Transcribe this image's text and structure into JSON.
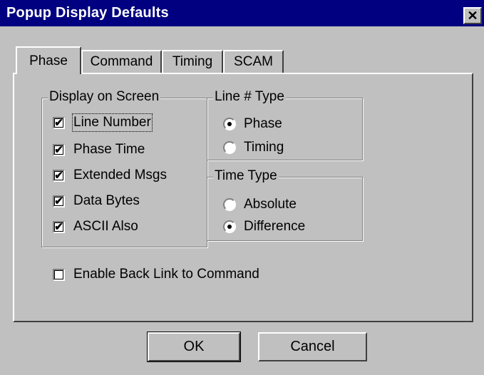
{
  "window": {
    "title": "Popup Display Defaults",
    "close_glyph": "✕"
  },
  "tabs": [
    {
      "label": "Phase",
      "active": true
    },
    {
      "label": "Command",
      "active": false
    },
    {
      "label": "Timing",
      "active": false
    },
    {
      "label": "SCAM",
      "active": false
    }
  ],
  "display_group": {
    "title": "Display on Screen",
    "items": [
      {
        "label": "Line Number",
        "checked": true
      },
      {
        "label": "Phase Time",
        "checked": true
      },
      {
        "label": "Extended Msgs",
        "checked": true
      },
      {
        "label": "Data Bytes",
        "checked": true
      },
      {
        "label": "ASCII Also",
        "checked": true
      }
    ]
  },
  "line_type_group": {
    "title": "Line # Type",
    "options": [
      {
        "label": "Phase",
        "selected": true
      },
      {
        "label": "Timing",
        "selected": false
      }
    ]
  },
  "time_type_group": {
    "title": "Time Type",
    "options": [
      {
        "label": "Absolute",
        "selected": false
      },
      {
        "label": "Difference",
        "selected": true
      }
    ]
  },
  "back_link": {
    "label": "Enable Back Link to Command",
    "checked": false
  },
  "buttons": {
    "ok": "OK",
    "cancel": "Cancel"
  },
  "icons": {
    "check": "✔"
  }
}
